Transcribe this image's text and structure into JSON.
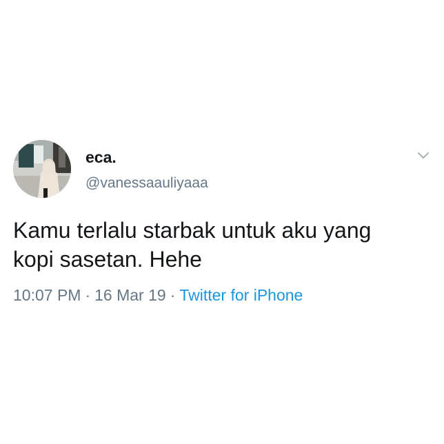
{
  "tweet": {
    "author": {
      "display_name": "eca.",
      "handle": "@vanessaauliyaaa"
    },
    "text": "Kamu terlalu starbak untuk aku yang\nkopi sasetan.  Hehe",
    "time": "10:07 PM",
    "date": "16 Mar 19",
    "separator": "·",
    "source": "Twitter for iPhone"
  },
  "icons": {
    "caret": "chevron-down-icon",
    "avatar": "avatar-photo"
  },
  "colors": {
    "text_primary": "#14171a",
    "text_secondary": "#657786",
    "link": "#1b95e0",
    "background": "#ffffff"
  }
}
